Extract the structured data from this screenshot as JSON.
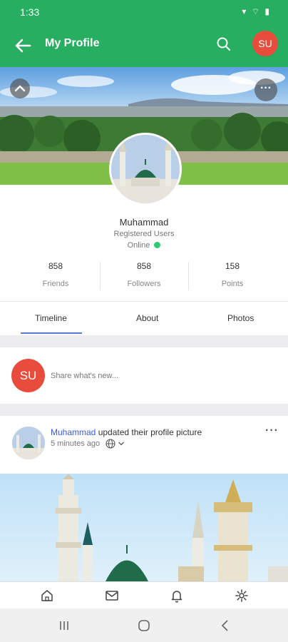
{
  "status_bar": {
    "time": "1:33"
  },
  "app_bar": {
    "title": "My Profile",
    "avatar_initials": "SU",
    "accent": "#27ae60"
  },
  "profile": {
    "name": "Muhammad",
    "role": "Registered Users",
    "status": "Online",
    "stats": [
      {
        "value": "858",
        "label": "Friends"
      },
      {
        "value": "858",
        "label": "Followers"
      },
      {
        "value": "158",
        "label": "Points"
      }
    ]
  },
  "tabs": [
    {
      "label": "Timeline",
      "active": true
    },
    {
      "label": "About",
      "active": false
    },
    {
      "label": "Photos",
      "active": false
    }
  ],
  "composer": {
    "avatar_initials": "SU",
    "prompt": "Share what's new..."
  },
  "post": {
    "author": "Muhammad",
    "action": "updated their profile picture",
    "time": "5 minutes ago"
  },
  "bottom_nav": [
    "home-icon",
    "mail-icon",
    "bell-icon",
    "gear-icon"
  ],
  "colors": {
    "avatar_bg": "#e74c3c",
    "online_dot": "#2ecc71",
    "tab_indicator": "#5b7bd5",
    "link": "#3b5bdb"
  }
}
